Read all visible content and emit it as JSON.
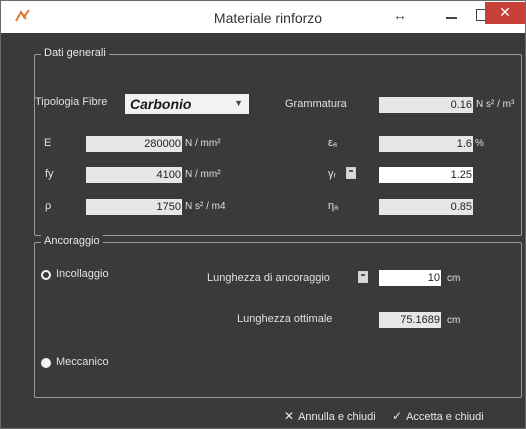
{
  "window": {
    "title": "Materiale rinforzo"
  },
  "titlebar": {
    "resize_glyph": "↔",
    "close_glyph": "✕"
  },
  "dati_generali": {
    "group_title": "Dati generali",
    "tipologia_label": "Tipologia Fibre",
    "tipologia_value": "Carbonio",
    "grammatura_label": "Grammatura",
    "grammatura_value": "0.16",
    "grammatura_unit": "N s² / m³",
    "E_label": "E",
    "E_value": "280000",
    "E_unit": "N / mm²",
    "fy_label": "fy",
    "fy_value": "4100",
    "fy_unit": "N / mm²",
    "rho_label": "ρ",
    "rho_value": "1750",
    "rho_unit": "N s² / m4",
    "eps_label": "εₐ",
    "eps_value": "1.6",
    "eps_unit": "%",
    "gamma_label": "γᵣ",
    "gamma_value": "1.25",
    "eta_label": "ηₐ",
    "eta_value": "0.85"
  },
  "ancoraggio": {
    "group_title": "Ancoraggio",
    "incollaggio_label": "Incollaggio",
    "meccanico_label": "Meccanico",
    "selected": "Incollaggio",
    "lunghezza_anc_label": "Lunghezza di ancoraggio",
    "lunghezza_anc_value": "10",
    "lunghezza_anc_unit": "cm",
    "lunghezza_ott_label": "Lunghezza ottimale",
    "lunghezza_ott_value": "75.1689",
    "lunghezza_ott_unit": "cm"
  },
  "footer": {
    "cancel_label": "Annulla e chiudi",
    "accept_label": "Accetta e chiudi"
  },
  "icons": {
    "app": "fiber-icon",
    "calc": "calculator-icon",
    "cancel": "x-icon",
    "accept": "check-icon"
  },
  "colors": {
    "close_button": "#c7403a",
    "window_bg": "#3a3a3a",
    "app_icon": "#e07a3c"
  }
}
